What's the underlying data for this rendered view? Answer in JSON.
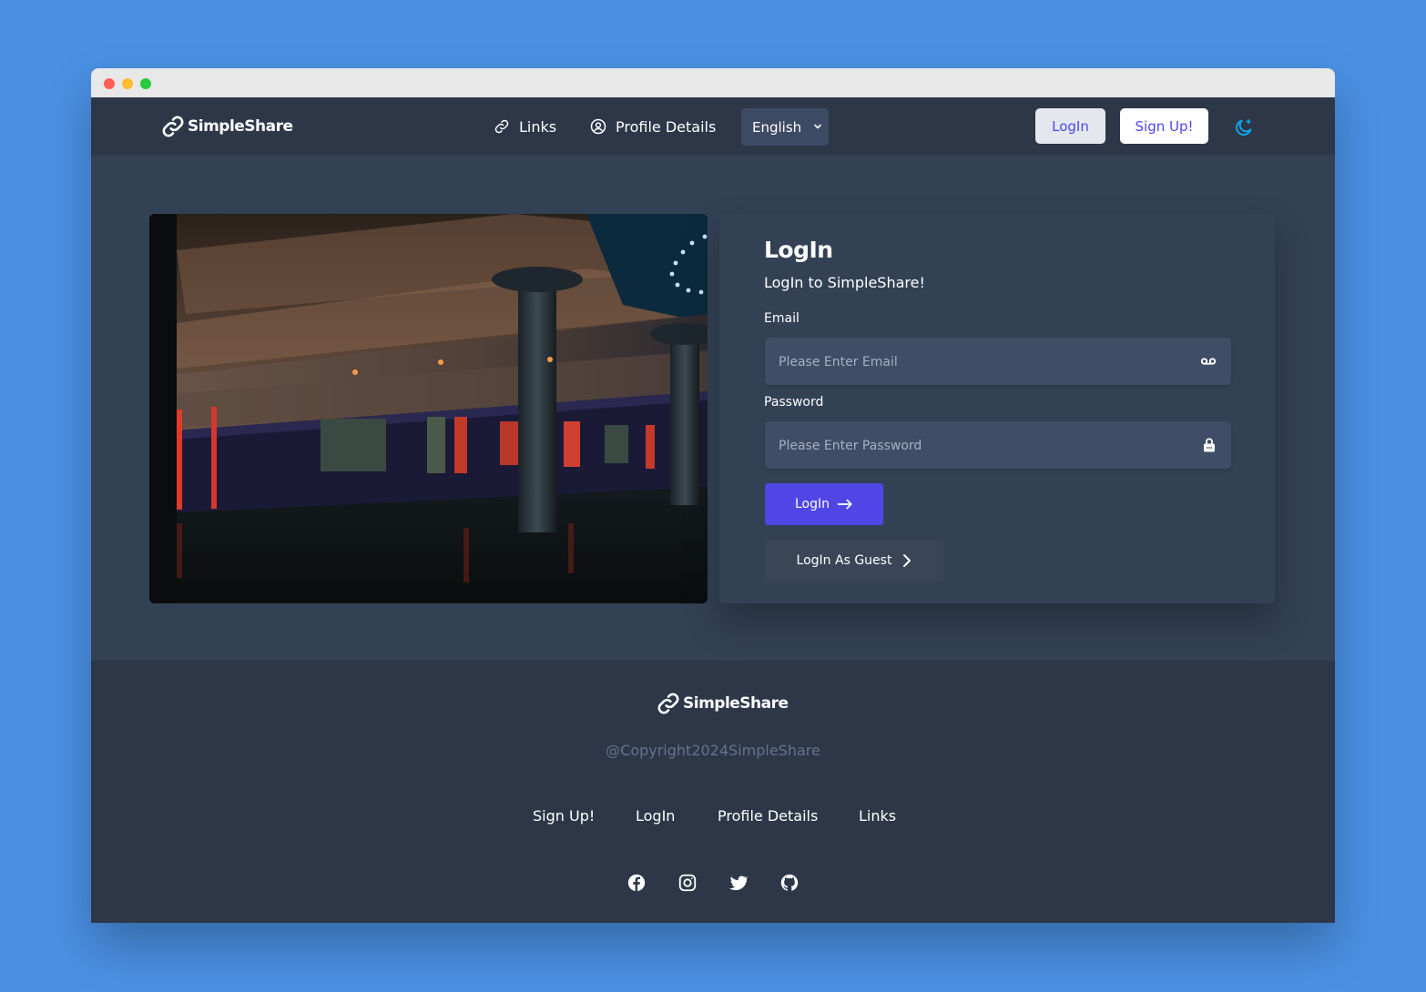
{
  "brand": {
    "name": "SimpleShare"
  },
  "nav": {
    "links_label": "Links",
    "profile_label": "Profile Details",
    "language": "English",
    "login_label": "LogIn",
    "signup_label": "Sign Up!"
  },
  "login_card": {
    "title": "LogIn",
    "subtitle": "LogIn to SimpleShare!",
    "email_label": "Email",
    "email_placeholder": "Please Enter Email",
    "password_label": "Password",
    "password_placeholder": "Please Enter Password",
    "submit_label": "LogIn",
    "guest_label": "LogIn As Guest"
  },
  "footer": {
    "brand": "SimpleShare",
    "copyright": "@Copyright2024SimpleShare",
    "links": [
      "Sign Up!",
      "LogIn",
      "Profile Details",
      "Links"
    ]
  },
  "icons": {
    "link": "link-icon",
    "profile": "user-circle-icon",
    "theme": "moon-stars-icon",
    "email": "voicemail-icon",
    "password": "lock-icon",
    "facebook": "facebook-icon",
    "instagram": "instagram-icon",
    "twitter": "twitter-icon",
    "github": "github-icon"
  },
  "colors": {
    "primary": "#4f46e5",
    "background": "#334155",
    "navbar": "#2d3748",
    "accent_blue": "#0ea5e9"
  }
}
